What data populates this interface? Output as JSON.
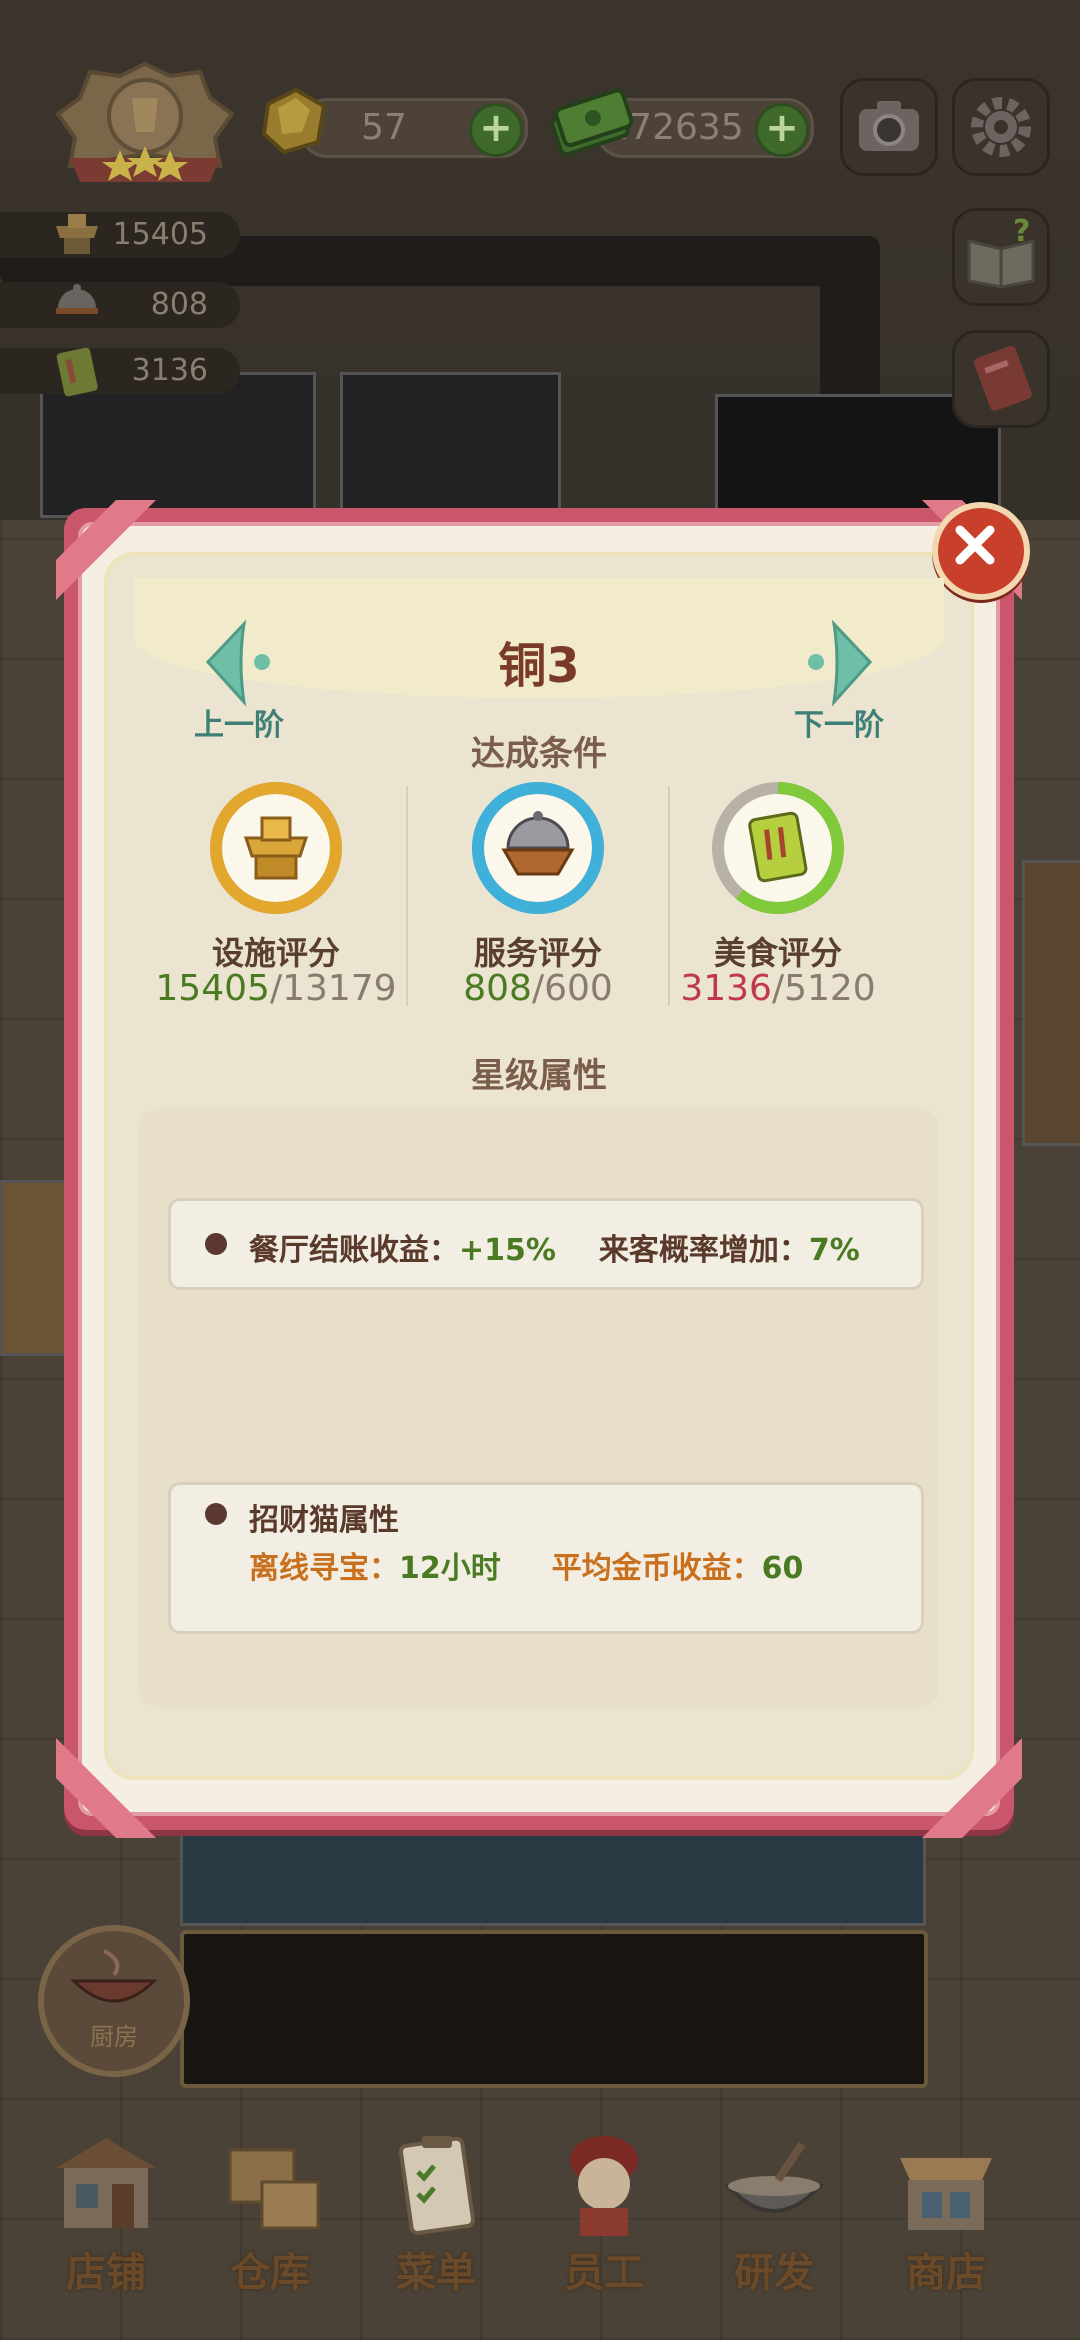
{
  "hud": {
    "gems": "57",
    "cash": "272635",
    "facility": "15405",
    "service": "808",
    "food": "3136"
  },
  "dialog": {
    "title": "铜3",
    "prev_label": "上一阶",
    "next_label": "下一阶",
    "conditions_heading": "达成条件",
    "metrics": [
      {
        "name": "设施评分",
        "current": "15405",
        "target": "/13179",
        "met": true,
        "progress": 1.0
      },
      {
        "name": "服务评分",
        "current": "808",
        "target": "/600",
        "met": true,
        "progress": 1.0
      },
      {
        "name": "美食评分",
        "current": "3136",
        "target": "/5120",
        "met": false,
        "progress": 0.61
      }
    ],
    "star_heading": "星级属性",
    "attr1": {
      "k1": "餐厅结账收益：",
      "v1": "+15%",
      "k2": "来客概率增加：",
      "v2": "7%"
    },
    "attr2": {
      "title": "招财猫属性",
      "k1": "离线寻宝：",
      "v1": "12小时",
      "k2": "平均金币收益：",
      "v2": "60"
    }
  },
  "nav": [
    {
      "label": "店铺"
    },
    {
      "label": "仓库"
    },
    {
      "label": "菜单"
    },
    {
      "label": "员工"
    },
    {
      "label": "研发"
    },
    {
      "label": "商店"
    }
  ],
  "kitchen_label": "厨房",
  "colors": {
    "met_green": "#4a7a22",
    "unmet_red": "#c0384a",
    "ring_gold": "#e3a72e",
    "ring_blue": "#3fb0d8",
    "ring_green": "#7fc93a",
    "frame_pink": "#c9566a"
  }
}
